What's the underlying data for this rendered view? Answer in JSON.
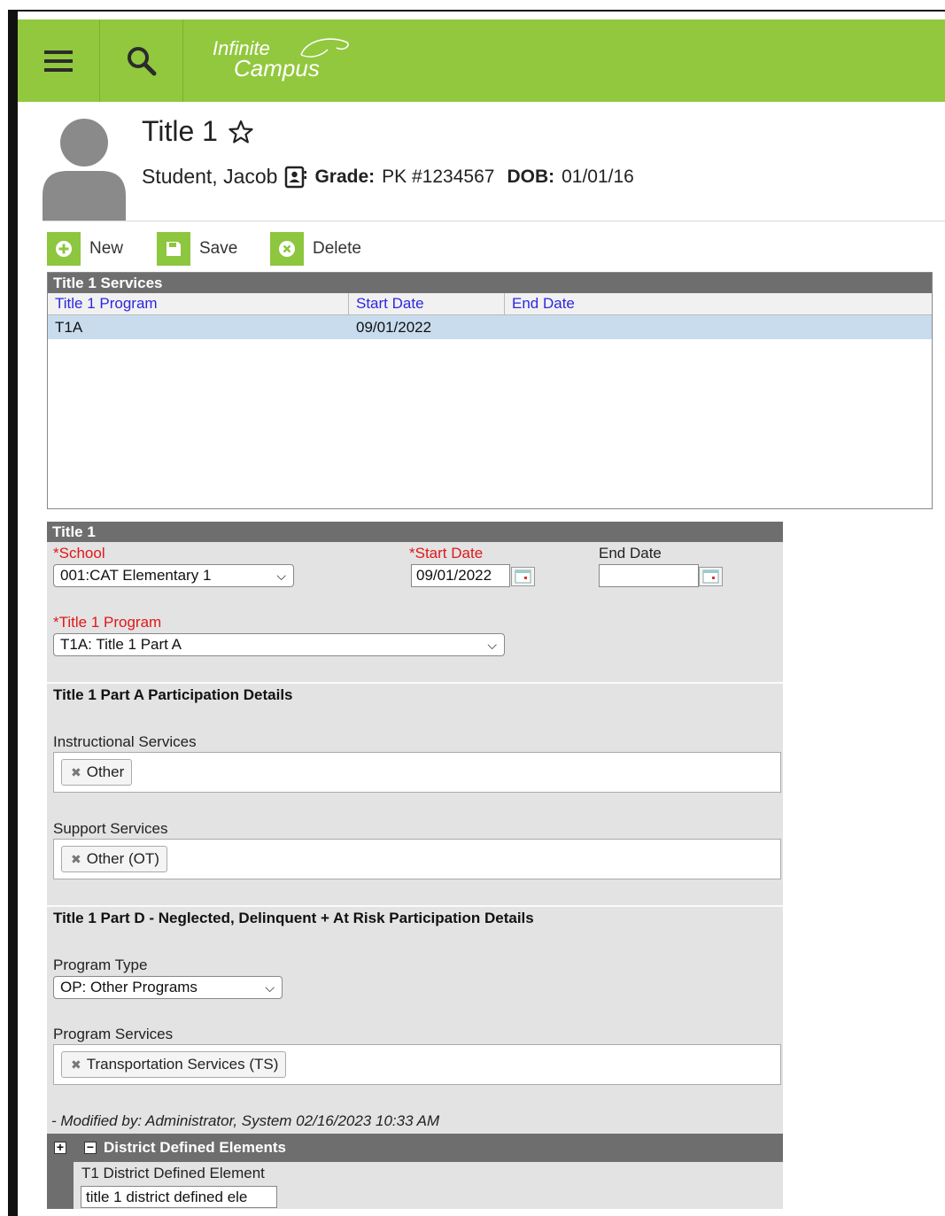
{
  "app": {
    "logo_line1": "Infinite",
    "logo_line2": "Campus"
  },
  "header": {
    "title": "Title 1",
    "student_name": "Student, Jacob",
    "grade_label": "Grade:",
    "grade_value": "PK #1234567",
    "dob_label": "DOB:",
    "dob_value": "01/01/16"
  },
  "actions": {
    "new": "New",
    "save": "Save",
    "delete": "Delete"
  },
  "services": {
    "heading": "Title 1 Services",
    "columns": [
      "Title 1 Program",
      "Start Date",
      "End Date"
    ],
    "rows": [
      {
        "program": "T1A",
        "start": "09/01/2022",
        "end": ""
      }
    ]
  },
  "form": {
    "heading": "Title 1",
    "school_label": "School",
    "school_value": "001:CAT Elementary 1",
    "start_label": "Start Date",
    "start_value": "09/01/2022",
    "end_label": "End Date",
    "end_value": "",
    "program_label": "Title 1 Program",
    "program_value": "T1A: Title 1 Part A",
    "part_a_heading": "Title 1 Part A Participation Details",
    "instructional_label": "Instructional Services",
    "instructional_tag": "Other",
    "support_label": "Support Services",
    "support_tag": "Other (OT)",
    "part_d_heading": "Title 1 Part D - Neglected, Delinquent + At Risk Participation Details",
    "program_type_label": "Program Type",
    "program_type_value": "OP: Other Programs",
    "program_services_label": "Program Services",
    "program_services_tag": "Transportation Services (TS)",
    "modified": "- Modified by: Administrator, System 02/16/2023 10:33 AM",
    "dde_heading": "District Defined Elements",
    "dde_field_label": "T1 District Defined Element",
    "dde_field_value": "title 1 district defined ele"
  }
}
